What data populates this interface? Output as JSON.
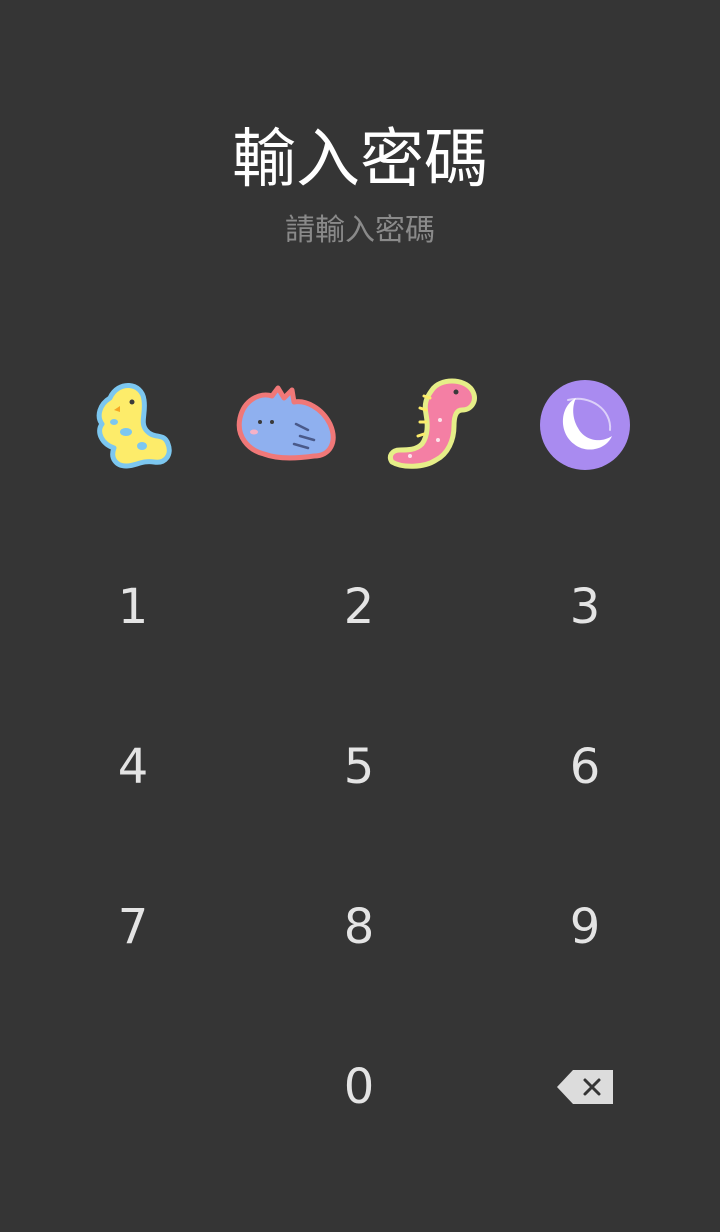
{
  "header": {
    "title": "輸入密碼",
    "subtitle": "請輸入密碼"
  },
  "pin_slots": [
    {
      "icon": "yellow-dinosaur-icon"
    },
    {
      "icon": "blue-triceratops-icon"
    },
    {
      "icon": "pink-longneck-dinosaur-icon"
    },
    {
      "icon": "purple-moon-icon"
    }
  ],
  "keypad": {
    "keys": [
      "1",
      "2",
      "3",
      "4",
      "5",
      "6",
      "7",
      "8",
      "9",
      "",
      "0",
      "backspace"
    ],
    "backspace_icon": "backspace-icon"
  },
  "colors": {
    "background": "#353535",
    "title": "#ffffff",
    "subtitle": "#8a8a8a",
    "digit": "#e4e4e4",
    "backspace": "#dcdcdc"
  }
}
